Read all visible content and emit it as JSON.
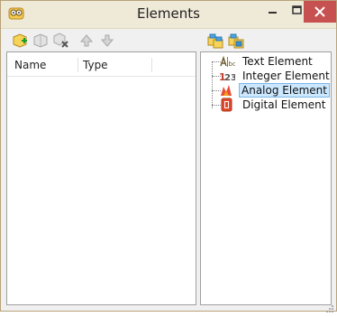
{
  "window": {
    "title": "Elements",
    "controls": {
      "minimize": "minimize-icon",
      "maximize": "maximize-icon",
      "close": "close-icon"
    }
  },
  "toolbar_left": [
    "add-element-icon",
    "copy-element-icon",
    "delete-element-icon",
    "move-up-icon",
    "move-down-icon"
  ],
  "toolbar_right": [
    "expand-all-icon",
    "collapse-all-icon"
  ],
  "list": {
    "columns": [
      "Name",
      "Type"
    ],
    "rows": []
  },
  "tree": {
    "items": [
      {
        "label": "Text Element",
        "icon": "text-element-icon"
      },
      {
        "label": "Integer Element",
        "icon": "integer-element-icon"
      },
      {
        "label": "Analog Element",
        "icon": "analog-element-icon",
        "selected": true
      },
      {
        "label": "Digital Element",
        "icon": "digital-element-icon"
      }
    ]
  },
  "colors": {
    "selection": "#cce8ff",
    "close_button": "#c75050",
    "border": "#b8a27a"
  }
}
